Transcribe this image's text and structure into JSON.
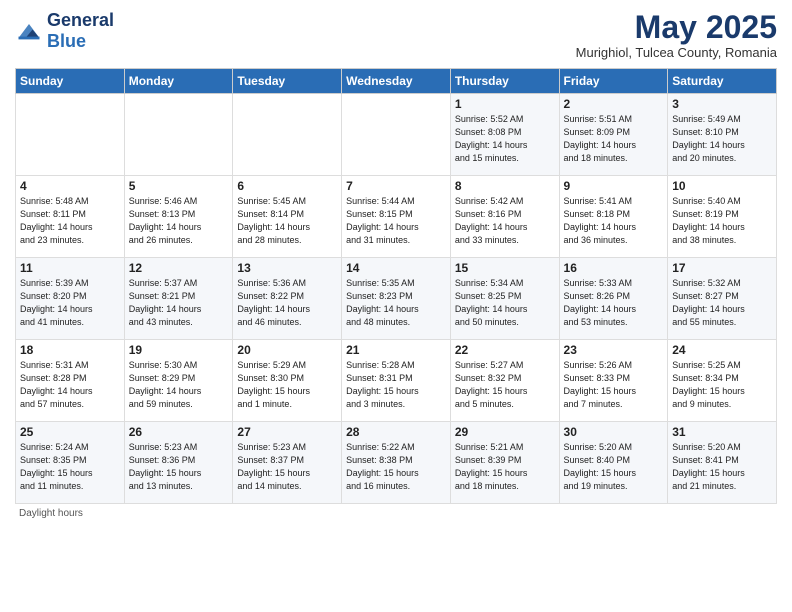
{
  "header": {
    "logo_general": "General",
    "logo_blue": "Blue",
    "month_title": "May 2025",
    "subtitle": "Murighiol, Tulcea County, Romania"
  },
  "weekdays": [
    "Sunday",
    "Monday",
    "Tuesday",
    "Wednesday",
    "Thursday",
    "Friday",
    "Saturday"
  ],
  "footer_text": "Daylight hours",
  "weeks": [
    [
      {
        "day": "",
        "info": ""
      },
      {
        "day": "",
        "info": ""
      },
      {
        "day": "",
        "info": ""
      },
      {
        "day": "",
        "info": ""
      },
      {
        "day": "1",
        "info": "Sunrise: 5:52 AM\nSunset: 8:08 PM\nDaylight: 14 hours\nand 15 minutes."
      },
      {
        "day": "2",
        "info": "Sunrise: 5:51 AM\nSunset: 8:09 PM\nDaylight: 14 hours\nand 18 minutes."
      },
      {
        "day": "3",
        "info": "Sunrise: 5:49 AM\nSunset: 8:10 PM\nDaylight: 14 hours\nand 20 minutes."
      }
    ],
    [
      {
        "day": "4",
        "info": "Sunrise: 5:48 AM\nSunset: 8:11 PM\nDaylight: 14 hours\nand 23 minutes."
      },
      {
        "day": "5",
        "info": "Sunrise: 5:46 AM\nSunset: 8:13 PM\nDaylight: 14 hours\nand 26 minutes."
      },
      {
        "day": "6",
        "info": "Sunrise: 5:45 AM\nSunset: 8:14 PM\nDaylight: 14 hours\nand 28 minutes."
      },
      {
        "day": "7",
        "info": "Sunrise: 5:44 AM\nSunset: 8:15 PM\nDaylight: 14 hours\nand 31 minutes."
      },
      {
        "day": "8",
        "info": "Sunrise: 5:42 AM\nSunset: 8:16 PM\nDaylight: 14 hours\nand 33 minutes."
      },
      {
        "day": "9",
        "info": "Sunrise: 5:41 AM\nSunset: 8:18 PM\nDaylight: 14 hours\nand 36 minutes."
      },
      {
        "day": "10",
        "info": "Sunrise: 5:40 AM\nSunset: 8:19 PM\nDaylight: 14 hours\nand 38 minutes."
      }
    ],
    [
      {
        "day": "11",
        "info": "Sunrise: 5:39 AM\nSunset: 8:20 PM\nDaylight: 14 hours\nand 41 minutes."
      },
      {
        "day": "12",
        "info": "Sunrise: 5:37 AM\nSunset: 8:21 PM\nDaylight: 14 hours\nand 43 minutes."
      },
      {
        "day": "13",
        "info": "Sunrise: 5:36 AM\nSunset: 8:22 PM\nDaylight: 14 hours\nand 46 minutes."
      },
      {
        "day": "14",
        "info": "Sunrise: 5:35 AM\nSunset: 8:23 PM\nDaylight: 14 hours\nand 48 minutes."
      },
      {
        "day": "15",
        "info": "Sunrise: 5:34 AM\nSunset: 8:25 PM\nDaylight: 14 hours\nand 50 minutes."
      },
      {
        "day": "16",
        "info": "Sunrise: 5:33 AM\nSunset: 8:26 PM\nDaylight: 14 hours\nand 53 minutes."
      },
      {
        "day": "17",
        "info": "Sunrise: 5:32 AM\nSunset: 8:27 PM\nDaylight: 14 hours\nand 55 minutes."
      }
    ],
    [
      {
        "day": "18",
        "info": "Sunrise: 5:31 AM\nSunset: 8:28 PM\nDaylight: 14 hours\nand 57 minutes."
      },
      {
        "day": "19",
        "info": "Sunrise: 5:30 AM\nSunset: 8:29 PM\nDaylight: 14 hours\nand 59 minutes."
      },
      {
        "day": "20",
        "info": "Sunrise: 5:29 AM\nSunset: 8:30 PM\nDaylight: 15 hours\nand 1 minute."
      },
      {
        "day": "21",
        "info": "Sunrise: 5:28 AM\nSunset: 8:31 PM\nDaylight: 15 hours\nand 3 minutes."
      },
      {
        "day": "22",
        "info": "Sunrise: 5:27 AM\nSunset: 8:32 PM\nDaylight: 15 hours\nand 5 minutes."
      },
      {
        "day": "23",
        "info": "Sunrise: 5:26 AM\nSunset: 8:33 PM\nDaylight: 15 hours\nand 7 minutes."
      },
      {
        "day": "24",
        "info": "Sunrise: 5:25 AM\nSunset: 8:34 PM\nDaylight: 15 hours\nand 9 minutes."
      }
    ],
    [
      {
        "day": "25",
        "info": "Sunrise: 5:24 AM\nSunset: 8:35 PM\nDaylight: 15 hours\nand 11 minutes."
      },
      {
        "day": "26",
        "info": "Sunrise: 5:23 AM\nSunset: 8:36 PM\nDaylight: 15 hours\nand 13 minutes."
      },
      {
        "day": "27",
        "info": "Sunrise: 5:23 AM\nSunset: 8:37 PM\nDaylight: 15 hours\nand 14 minutes."
      },
      {
        "day": "28",
        "info": "Sunrise: 5:22 AM\nSunset: 8:38 PM\nDaylight: 15 hours\nand 16 minutes."
      },
      {
        "day": "29",
        "info": "Sunrise: 5:21 AM\nSunset: 8:39 PM\nDaylight: 15 hours\nand 18 minutes."
      },
      {
        "day": "30",
        "info": "Sunrise: 5:20 AM\nSunset: 8:40 PM\nDaylight: 15 hours\nand 19 minutes."
      },
      {
        "day": "31",
        "info": "Sunrise: 5:20 AM\nSunset: 8:41 PM\nDaylight: 15 hours\nand 21 minutes."
      }
    ]
  ]
}
